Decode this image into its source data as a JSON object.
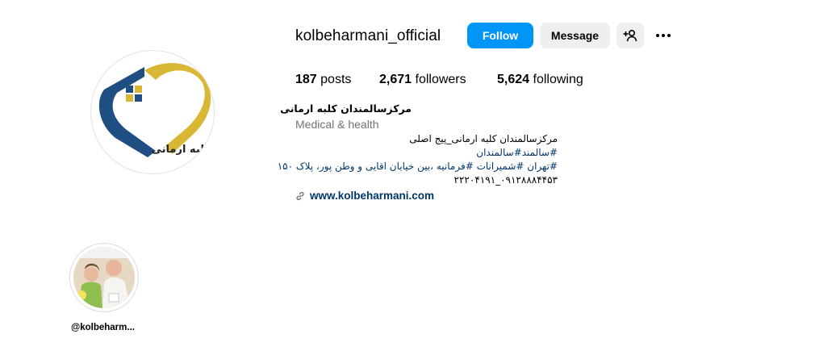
{
  "profile": {
    "username": "kolbeharmani_official",
    "full_name": "مرکزسالمندان کلبه ارمانی",
    "category": "Medical & health",
    "logo_text": "کلبه ارمانی",
    "avatar_icon": "heart-house-logo"
  },
  "actions": {
    "follow_label": "Follow",
    "message_label": "Message",
    "suggest_icon": "add-person-icon",
    "more_icon": "more-options-icon"
  },
  "stats": {
    "posts_count": "187",
    "posts_label": "posts",
    "followers_count": "2,671",
    "followers_label": "followers",
    "following_count": "5,624",
    "following_label": "following"
  },
  "bio": {
    "line1": "مرکزسالمندان کلبه ارمانی_پیج اصلی",
    "line2": "#سالمند#سالمندان",
    "line3": "#تهران #شمیرانات #فرمانیه ،بین خیابان اقایی و وطن پور، پلاک ۱۵۰",
    "line4": "۰۹۱۲۸۸۸۴۴۵۳_۲۲۲۰۴۱۹۱"
  },
  "link": {
    "icon": "link-icon",
    "text": "www.kolbeharmani.com"
  },
  "highlights": [
    {
      "label": "@kolbeharm...",
      "image": "elderly-care-photo"
    }
  ],
  "colors": {
    "follow_button": "#0095f6",
    "secondary_button": "#efefef",
    "link": "#00376b",
    "logo_blue": "#1f4f82",
    "logo_gold": "#d8b735"
  }
}
